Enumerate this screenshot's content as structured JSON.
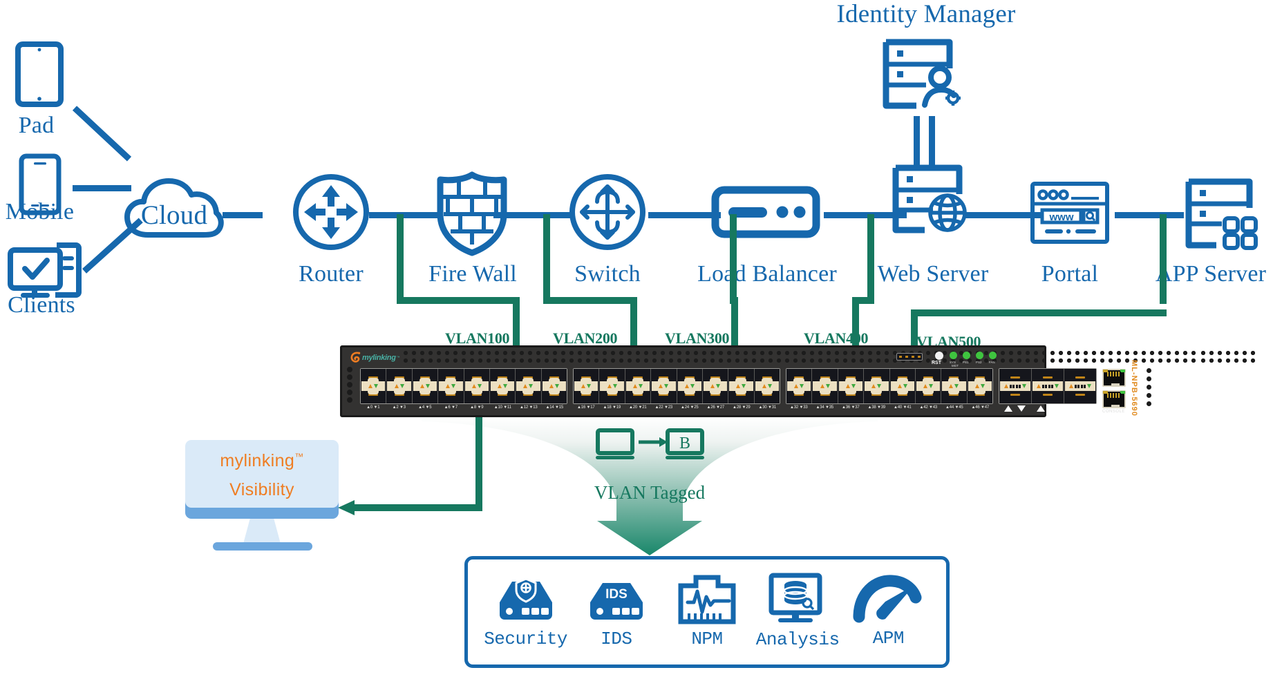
{
  "colors": {
    "blue": "#1668ad",
    "green": "#16785f",
    "orange": "#ef7d22",
    "teal": "#49b3a6",
    "screen_bg": "#daeaf8"
  },
  "access_devices": [
    {
      "label": "Pad",
      "icon": "tablet-icon"
    },
    {
      "label": "Mobile",
      "icon": "smartphone-icon"
    },
    {
      "label": "Clients",
      "icon": "desktop-check-icon"
    }
  ],
  "cloud": {
    "label": "Cloud",
    "icon": "cloud-icon"
  },
  "network_chain": [
    {
      "label": "Router",
      "icon": "router-arrows-icon"
    },
    {
      "label": "Fire Wall",
      "icon": "shield-brick-icon"
    },
    {
      "label": "Switch",
      "icon": "switch-arrows-icon"
    },
    {
      "label": "Load Balancer",
      "icon": "load-balancer-icon"
    },
    {
      "label": "Web Server",
      "icon": "server-globe-icon"
    },
    {
      "label": "Portal",
      "icon": "browser-www-icon"
    },
    {
      "label": "APP Server",
      "icon": "server-apps-icon"
    }
  ],
  "identity_manager": {
    "label": "Identity Manager",
    "icon": "server-user-gear-icon"
  },
  "vlans": [
    {
      "label": "VLAN100"
    },
    {
      "label": "VLAN200"
    },
    {
      "label": "VLAN300"
    },
    {
      "label": "VLAN400"
    },
    {
      "label": "VLAN500"
    }
  ],
  "network_packet_broker": {
    "brand": "mylinking",
    "brand_tm": "™",
    "model": "ML-NPB-5690",
    "reset_label": "RST",
    "console_label": "CONSOLE",
    "leds": [
      {
        "label": "SYS"
      },
      {
        "label": "MGT"
      },
      {
        "label": "PS1"
      },
      {
        "label": "PS2"
      },
      {
        "label": "FAN"
      }
    ],
    "port_numbers": [
      "0",
      "1",
      "2",
      "3",
      "4",
      "5",
      "6",
      "7",
      "8",
      "9",
      "10",
      "11",
      "12",
      "13",
      "14",
      "15",
      "16",
      "17",
      "18",
      "19",
      "20",
      "21",
      "22",
      "23",
      "24",
      "25",
      "26",
      "27",
      "28",
      "29",
      "30",
      "31",
      "32",
      "33",
      "34",
      "35",
      "36",
      "37",
      "38",
      "39",
      "40",
      "41",
      "42",
      "43",
      "44",
      "45",
      "46",
      "47"
    ],
    "uplink_count": 3
  },
  "vlan_tagged": {
    "label": "VLAN Tagged",
    "tag_letter": "B"
  },
  "visibility_monitor": {
    "line1": "mylinking",
    "tm": "™",
    "line2": "Visibility"
  },
  "tools": [
    {
      "label": "Security",
      "icon": "security-appliance-icon"
    },
    {
      "label": "IDS",
      "icon": "ids-appliance-icon",
      "badge": "IDS"
    },
    {
      "label": "NPM",
      "icon": "npm-waveform-icon"
    },
    {
      "label": "Analysis",
      "icon": "analysis-database-icon"
    },
    {
      "label": "APM",
      "icon": "apm-gauge-icon"
    }
  ]
}
